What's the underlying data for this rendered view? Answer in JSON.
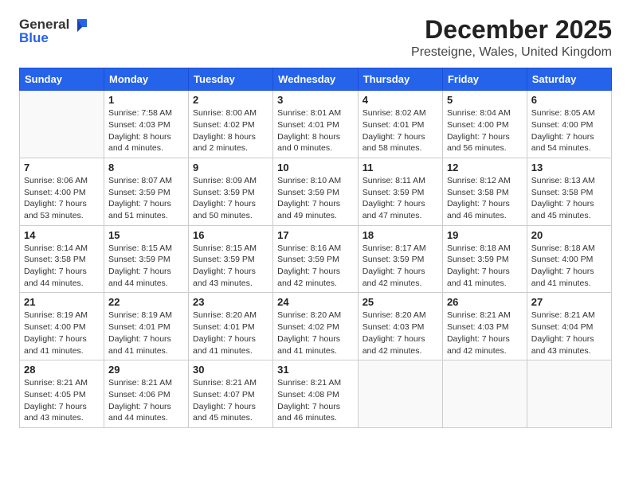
{
  "header": {
    "logo_line1": "General",
    "logo_line2": "Blue",
    "main_title": "December 2025",
    "subtitle": "Presteigne, Wales, United Kingdom"
  },
  "days_of_week": [
    "Sunday",
    "Monday",
    "Tuesday",
    "Wednesday",
    "Thursday",
    "Friday",
    "Saturday"
  ],
  "weeks": [
    [
      {
        "day": "",
        "info": ""
      },
      {
        "day": "1",
        "info": "Sunrise: 7:58 AM\nSunset: 4:03 PM\nDaylight: 8 hours\nand 4 minutes."
      },
      {
        "day": "2",
        "info": "Sunrise: 8:00 AM\nSunset: 4:02 PM\nDaylight: 8 hours\nand 2 minutes."
      },
      {
        "day": "3",
        "info": "Sunrise: 8:01 AM\nSunset: 4:01 PM\nDaylight: 8 hours\nand 0 minutes."
      },
      {
        "day": "4",
        "info": "Sunrise: 8:02 AM\nSunset: 4:01 PM\nDaylight: 7 hours\nand 58 minutes."
      },
      {
        "day": "5",
        "info": "Sunrise: 8:04 AM\nSunset: 4:00 PM\nDaylight: 7 hours\nand 56 minutes."
      },
      {
        "day": "6",
        "info": "Sunrise: 8:05 AM\nSunset: 4:00 PM\nDaylight: 7 hours\nand 54 minutes."
      }
    ],
    [
      {
        "day": "7",
        "info": "Sunrise: 8:06 AM\nSunset: 4:00 PM\nDaylight: 7 hours\nand 53 minutes."
      },
      {
        "day": "8",
        "info": "Sunrise: 8:07 AM\nSunset: 3:59 PM\nDaylight: 7 hours\nand 51 minutes."
      },
      {
        "day": "9",
        "info": "Sunrise: 8:09 AM\nSunset: 3:59 PM\nDaylight: 7 hours\nand 50 minutes."
      },
      {
        "day": "10",
        "info": "Sunrise: 8:10 AM\nSunset: 3:59 PM\nDaylight: 7 hours\nand 49 minutes."
      },
      {
        "day": "11",
        "info": "Sunrise: 8:11 AM\nSunset: 3:59 PM\nDaylight: 7 hours\nand 47 minutes."
      },
      {
        "day": "12",
        "info": "Sunrise: 8:12 AM\nSunset: 3:58 PM\nDaylight: 7 hours\nand 46 minutes."
      },
      {
        "day": "13",
        "info": "Sunrise: 8:13 AM\nSunset: 3:58 PM\nDaylight: 7 hours\nand 45 minutes."
      }
    ],
    [
      {
        "day": "14",
        "info": "Sunrise: 8:14 AM\nSunset: 3:58 PM\nDaylight: 7 hours\nand 44 minutes."
      },
      {
        "day": "15",
        "info": "Sunrise: 8:15 AM\nSunset: 3:59 PM\nDaylight: 7 hours\nand 44 minutes."
      },
      {
        "day": "16",
        "info": "Sunrise: 8:15 AM\nSunset: 3:59 PM\nDaylight: 7 hours\nand 43 minutes."
      },
      {
        "day": "17",
        "info": "Sunrise: 8:16 AM\nSunset: 3:59 PM\nDaylight: 7 hours\nand 42 minutes."
      },
      {
        "day": "18",
        "info": "Sunrise: 8:17 AM\nSunset: 3:59 PM\nDaylight: 7 hours\nand 42 minutes."
      },
      {
        "day": "19",
        "info": "Sunrise: 8:18 AM\nSunset: 3:59 PM\nDaylight: 7 hours\nand 41 minutes."
      },
      {
        "day": "20",
        "info": "Sunrise: 8:18 AM\nSunset: 4:00 PM\nDaylight: 7 hours\nand 41 minutes."
      }
    ],
    [
      {
        "day": "21",
        "info": "Sunrise: 8:19 AM\nSunset: 4:00 PM\nDaylight: 7 hours\nand 41 minutes."
      },
      {
        "day": "22",
        "info": "Sunrise: 8:19 AM\nSunset: 4:01 PM\nDaylight: 7 hours\nand 41 minutes."
      },
      {
        "day": "23",
        "info": "Sunrise: 8:20 AM\nSunset: 4:01 PM\nDaylight: 7 hours\nand 41 minutes."
      },
      {
        "day": "24",
        "info": "Sunrise: 8:20 AM\nSunset: 4:02 PM\nDaylight: 7 hours\nand 41 minutes."
      },
      {
        "day": "25",
        "info": "Sunrise: 8:20 AM\nSunset: 4:03 PM\nDaylight: 7 hours\nand 42 minutes."
      },
      {
        "day": "26",
        "info": "Sunrise: 8:21 AM\nSunset: 4:03 PM\nDaylight: 7 hours\nand 42 minutes."
      },
      {
        "day": "27",
        "info": "Sunrise: 8:21 AM\nSunset: 4:04 PM\nDaylight: 7 hours\nand 43 minutes."
      }
    ],
    [
      {
        "day": "28",
        "info": "Sunrise: 8:21 AM\nSunset: 4:05 PM\nDaylight: 7 hours\nand 43 minutes."
      },
      {
        "day": "29",
        "info": "Sunrise: 8:21 AM\nSunset: 4:06 PM\nDaylight: 7 hours\nand 44 minutes."
      },
      {
        "day": "30",
        "info": "Sunrise: 8:21 AM\nSunset: 4:07 PM\nDaylight: 7 hours\nand 45 minutes."
      },
      {
        "day": "31",
        "info": "Sunrise: 8:21 AM\nSunset: 4:08 PM\nDaylight: 7 hours\nand 46 minutes."
      },
      {
        "day": "",
        "info": ""
      },
      {
        "day": "",
        "info": ""
      },
      {
        "day": "",
        "info": ""
      }
    ]
  ]
}
